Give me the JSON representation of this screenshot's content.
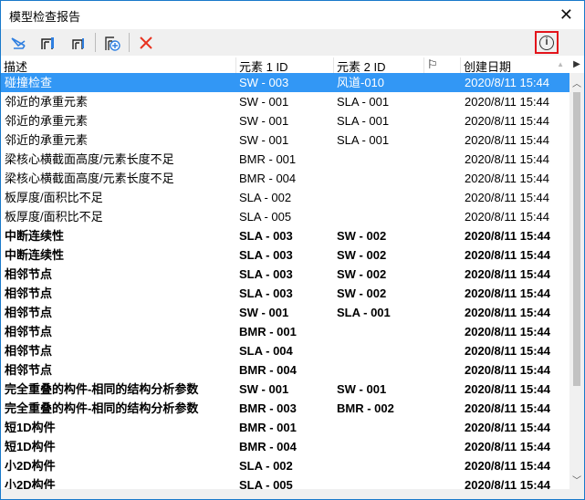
{
  "window": {
    "title": "模型检查报告"
  },
  "toolbar": {
    "buttons": [
      "select-elements-icon",
      "highlight-element-1-icon",
      "highlight-element-2-icon",
      "add-to-selection-icon",
      "delete-icon"
    ],
    "info": "info-icon"
  },
  "columns": [
    "描述",
    "元素 1 ID",
    "元素 2 ID",
    "",
    "创建日期"
  ],
  "rows": [
    {
      "d": "碰撞检查",
      "e1": "SW - 003",
      "e2": "风道-010",
      "t": "2020/8/11 15:44",
      "sel": true,
      "b": false
    },
    {
      "d": "邻近的承重元素",
      "e1": "SW - 001",
      "e2": "SLA - 001",
      "t": "2020/8/11 15:44",
      "b": false
    },
    {
      "d": "邻近的承重元素",
      "e1": "SW - 001",
      "e2": "SLA - 001",
      "t": "2020/8/11 15:44",
      "b": false
    },
    {
      "d": "邻近的承重元素",
      "e1": "SW - 001",
      "e2": "SLA - 001",
      "t": "2020/8/11 15:44",
      "b": false
    },
    {
      "d": "梁核心横截面高度/元素长度不足",
      "e1": "BMR - 001",
      "e2": "",
      "t": "2020/8/11 15:44",
      "b": false
    },
    {
      "d": "梁核心横截面高度/元素长度不足",
      "e1": "BMR - 004",
      "e2": "",
      "t": "2020/8/11 15:44",
      "b": false
    },
    {
      "d": "板厚度/面积比不足",
      "e1": "SLA - 002",
      "e2": "",
      "t": "2020/8/11 15:44",
      "b": false
    },
    {
      "d": "板厚度/面积比不足",
      "e1": "SLA - 005",
      "e2": "",
      "t": "2020/8/11 15:44",
      "b": false
    },
    {
      "d": "中断连续性",
      "e1": "SLA - 003",
      "e2": "SW - 002",
      "t": "2020/8/11 15:44",
      "b": true
    },
    {
      "d": "中断连续性",
      "e1": "SLA - 003",
      "e2": "SW - 002",
      "t": "2020/8/11 15:44",
      "b": true
    },
    {
      "d": "相邻节点",
      "e1": "SLA - 003",
      "e2": "SW - 002",
      "t": "2020/8/11 15:44",
      "b": true
    },
    {
      "d": "相邻节点",
      "e1": "SLA - 003",
      "e2": "SW - 002",
      "t": "2020/8/11 15:44",
      "b": true
    },
    {
      "d": "相邻节点",
      "e1": "SW - 001",
      "e2": "SLA - 001",
      "t": "2020/8/11 15:44",
      "b": true
    },
    {
      "d": "相邻节点",
      "e1": "BMR - 001",
      "e2": "",
      "t": "2020/8/11 15:44",
      "b": true
    },
    {
      "d": "相邻节点",
      "e1": "SLA - 004",
      "e2": "",
      "t": "2020/8/11 15:44",
      "b": true
    },
    {
      "d": "相邻节点",
      "e1": "BMR - 004",
      "e2": "",
      "t": "2020/8/11 15:44",
      "b": true
    },
    {
      "d": "完全重叠的构件-相同的结构分析参数",
      "e1": "SW - 001",
      "e2": "SW - 001",
      "t": "2020/8/11 15:44",
      "b": true
    },
    {
      "d": "完全重叠的构件-相同的结构分析参数",
      "e1": "BMR - 003",
      "e2": "BMR - 002",
      "t": "2020/8/11 15:44",
      "b": true
    },
    {
      "d": "短1D构件",
      "e1": "BMR - 001",
      "e2": "",
      "t": "2020/8/11 15:44",
      "b": true
    },
    {
      "d": "短1D构件",
      "e1": "BMR - 004",
      "e2": "",
      "t": "2020/8/11 15:44",
      "b": true
    },
    {
      "d": "小2D构件",
      "e1": "SLA - 002",
      "e2": "",
      "t": "2020/8/11 15:44",
      "b": true
    },
    {
      "d": "小2D构件",
      "e1": "SLA - 005",
      "e2": "",
      "t": "2020/8/11 15:44",
      "b": true
    }
  ]
}
